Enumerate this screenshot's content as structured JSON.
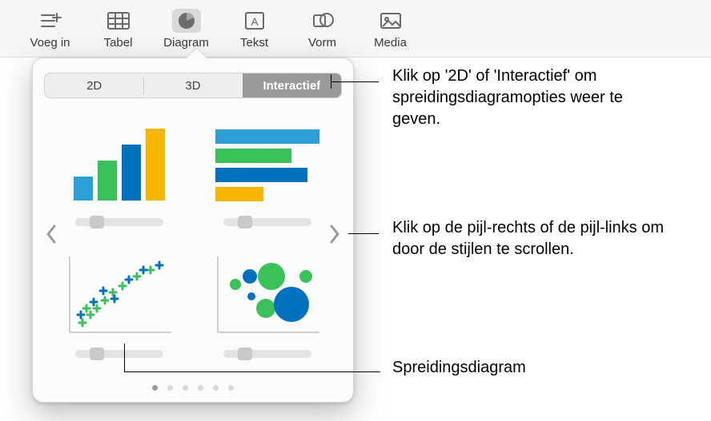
{
  "toolbar": {
    "items": [
      {
        "label": "Voeg in",
        "icon": "insert"
      },
      {
        "label": "Tabel",
        "icon": "table"
      },
      {
        "label": "Diagram",
        "icon": "chart",
        "selected": true
      },
      {
        "label": "Tekst",
        "icon": "text"
      },
      {
        "label": "Vorm",
        "icon": "shape"
      },
      {
        "label": "Media",
        "icon": "media"
      }
    ]
  },
  "segmented": {
    "tabs": [
      {
        "label": "2D",
        "active": false
      },
      {
        "label": "3D",
        "active": false
      },
      {
        "label": "Interactief",
        "active": true
      }
    ]
  },
  "chart_grid": {
    "tiles": [
      {
        "name": "vertical-bar-chart"
      },
      {
        "name": "horizontal-bar-chart"
      },
      {
        "name": "scatter-chart"
      },
      {
        "name": "bubble-chart"
      }
    ]
  },
  "paging": {
    "dot_count": 6,
    "active_index": 0
  },
  "callouts": {
    "tabs": "Klik op '2D' of 'Interactief' om spreidingsdiagramopties weer te geven.",
    "arrows": "Klik op de pijl-rechts of de pijl-links om door de stijlen te scrollen.",
    "scatter": "Spreidingsdiagram"
  },
  "colors": {
    "blue1": "#2e9ed6",
    "green": "#3bc15a",
    "yellow": "#f6b600",
    "blue2": "#0071bc"
  }
}
